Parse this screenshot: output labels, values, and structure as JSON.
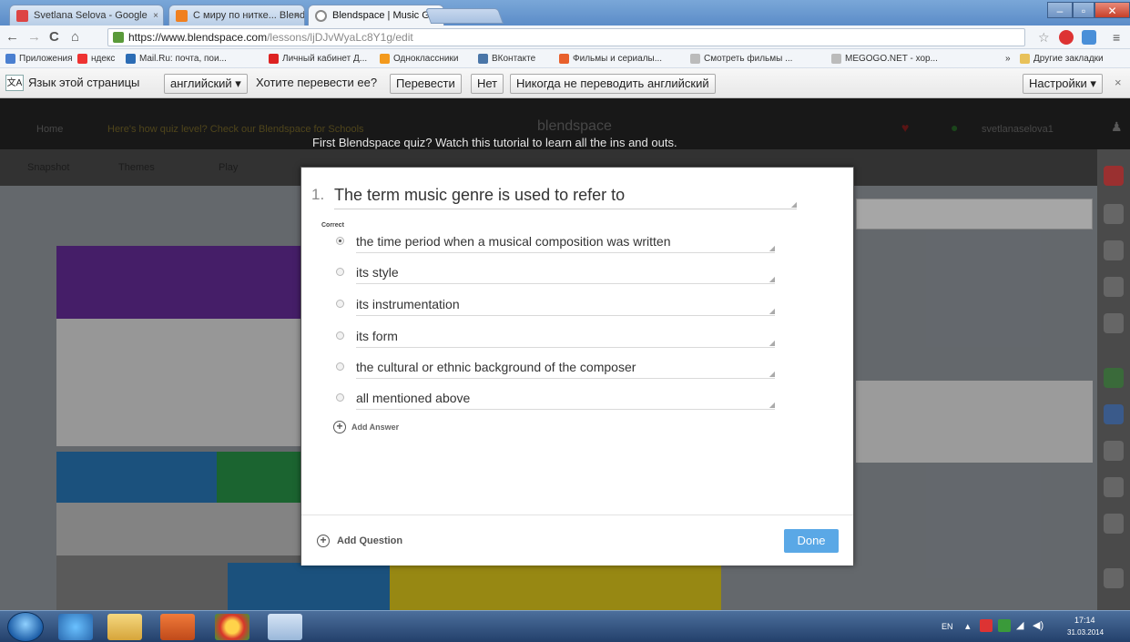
{
  "browser": {
    "tabs": [
      {
        "title": "Svetlana Selova - Google",
        "active": false
      },
      {
        "title": "С миру по нитке... Blend",
        "active": false
      },
      {
        "title": "Blendspace | Music Genre",
        "active": true
      }
    ],
    "close_glyph": "×",
    "url_host": "https://www.blendspace.com",
    "url_path": "/lessons/ljDJvWyaLc8Y1g/edit",
    "window_controls": {
      "minimize": "–",
      "maximize": "▫",
      "close": "✕"
    },
    "nav": {
      "back": "←",
      "forward": "→",
      "reload": "C",
      "home": "⌂"
    },
    "menu_glyph": "≡"
  },
  "bookmarks": [
    {
      "label": "Приложения",
      "color": "#4a7fd0"
    },
    {
      "label": "ндекс",
      "color": "#e33"
    },
    {
      "label": "Mail.Ru: почта, пои...",
      "color": "#2b6cb5"
    },
    {
      "label": "Личный кабинет Д...",
      "color": "#d22"
    },
    {
      "label": "Одноклассники",
      "color": "#f39a1e"
    },
    {
      "label": "ВКонтакте",
      "color": "#4a76a8"
    },
    {
      "label": "Фильмы и сериалы...",
      "color": "#e8602c"
    },
    {
      "label": "Смотреть фильмы ...",
      "color": "#bbb"
    },
    {
      "label": "MEGOGO.NET - хор...",
      "color": "#bbb"
    },
    {
      "label": "Другие закладки",
      "color": "#e8c15a"
    }
  ],
  "bookmarks_more": "»",
  "translate_bar": {
    "icon": "文A",
    "page_language_label": "Язык этой страницы",
    "language": "английский ▾",
    "question": "Хотите перевести ее?",
    "translate": "Перевести",
    "no": "Нет",
    "never": "Никогда не переводить английский",
    "settings": "Настройки ▾",
    "close": "×"
  },
  "site": {
    "logo": "blendspace",
    "banner": "First Blendspace quiz? Watch this tutorial to learn all the ins and outs.",
    "header_left": "Home",
    "header_link": "Here's how quiz level? Check our Blendspace for Schools",
    "user": "svetlanaselova1",
    "subnav": [
      "Snapshot",
      "Themes",
      "Play"
    ]
  },
  "quiz": {
    "number": "1.",
    "question": "The term music genre is used to refer to",
    "correct_label": "Correct",
    "answers": [
      {
        "text": "the time period when a musical composition was written",
        "checked": true
      },
      {
        "text": "its style",
        "checked": false
      },
      {
        "text": "its instrumentation",
        "checked": false
      },
      {
        "text": "its form",
        "checked": false
      },
      {
        "text": "the cultural or ethnic background of the composer",
        "checked": false
      },
      {
        "text": "all mentioned above",
        "checked": false
      }
    ],
    "add_answer": "Add Answer",
    "add_question": "Add Question",
    "done": "Done",
    "plus": "+",
    "resize_glyph": "◢"
  },
  "taskbar": {
    "lang": "EN",
    "time": "17:14",
    "date": "31.03.2014"
  },
  "colors": {
    "done_button": "#5aa8e6",
    "header_bg": "#262626",
    "purple_tile": "#6a2ea0",
    "blue_tile": "#2a7dc0",
    "yellow_tile": "#e8d21e"
  }
}
